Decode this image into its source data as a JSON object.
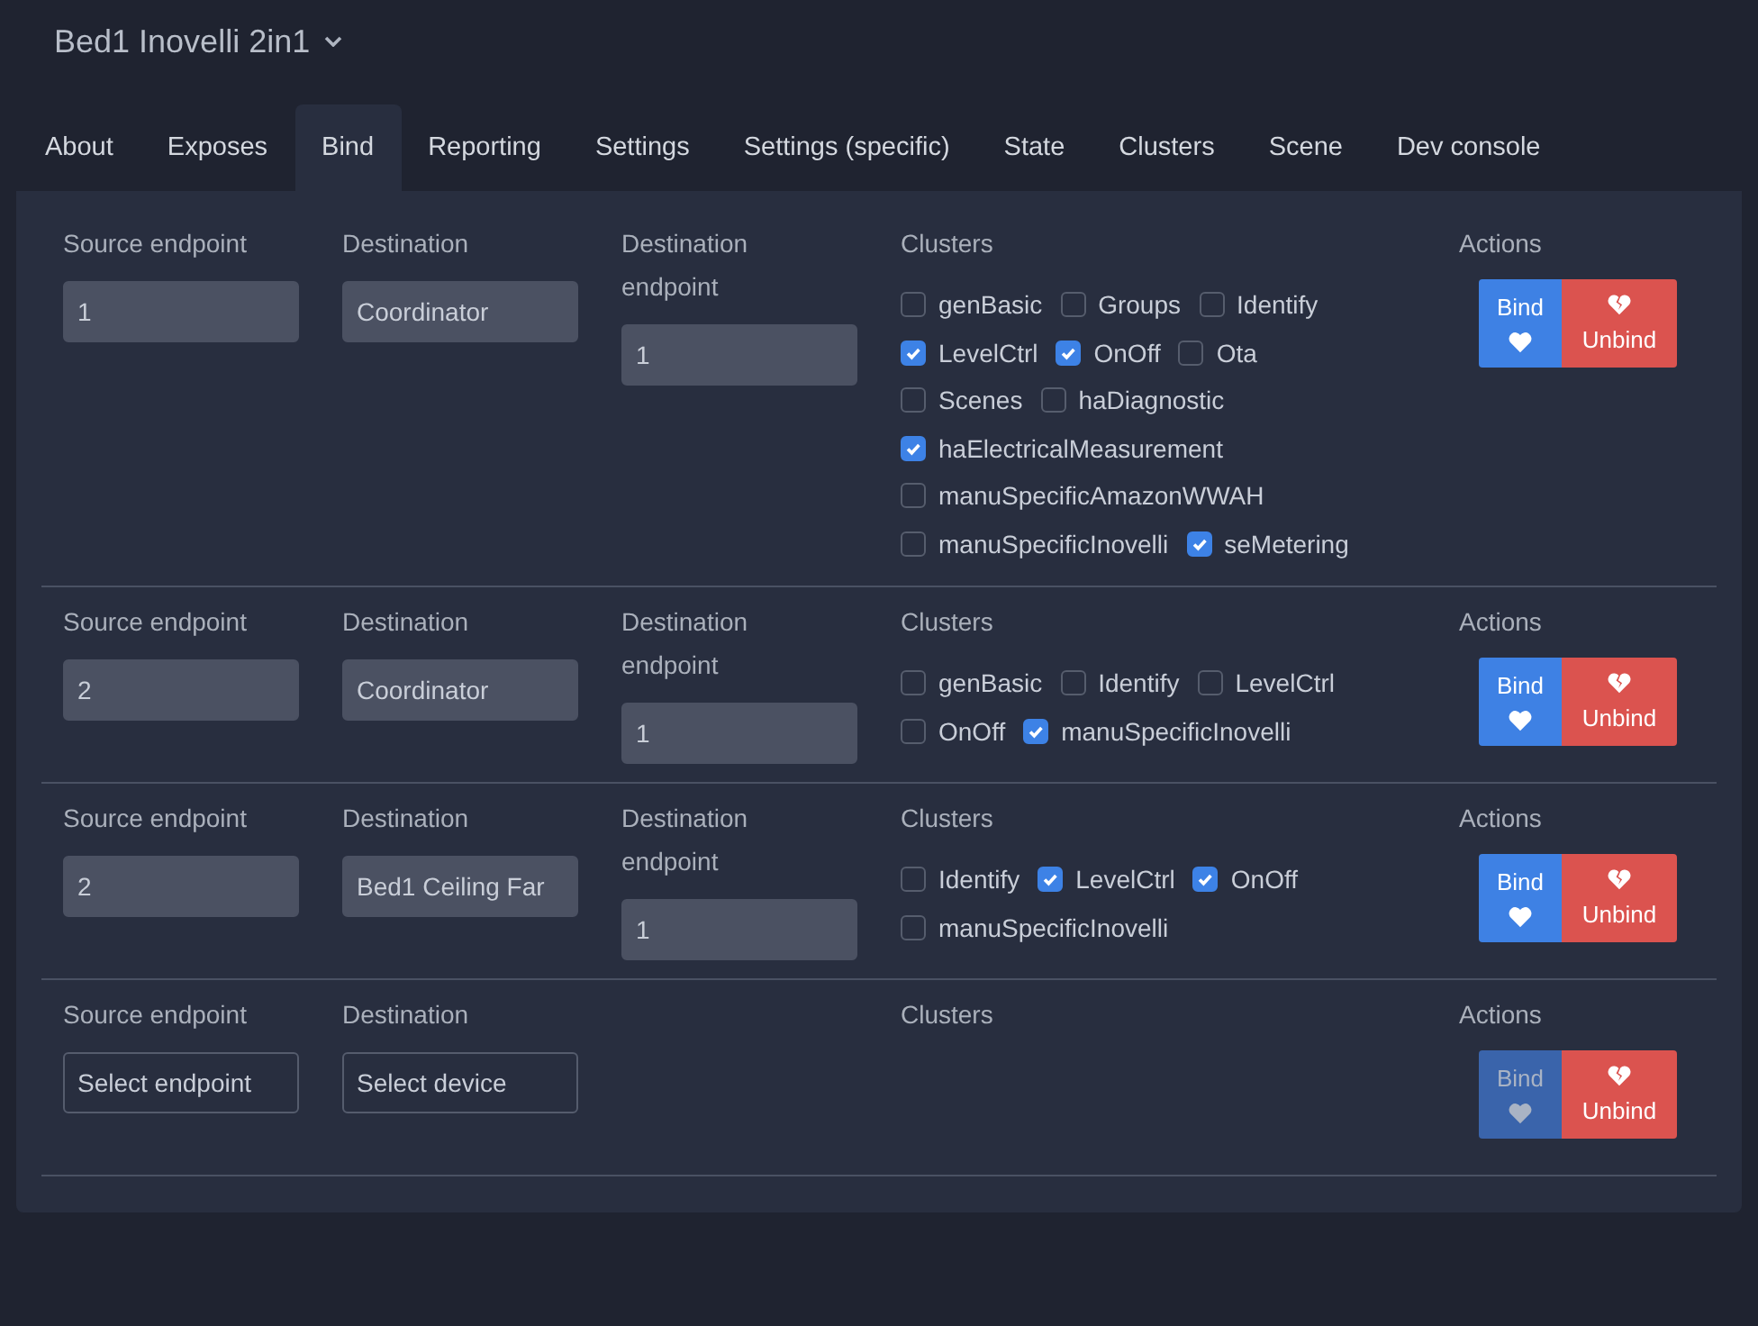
{
  "device": {
    "title": "Bed1 Inovelli 2in1"
  },
  "tabs": [
    {
      "label": "About",
      "selected": false
    },
    {
      "label": "Exposes",
      "selected": false
    },
    {
      "label": "Bind",
      "selected": true
    },
    {
      "label": "Reporting",
      "selected": false
    },
    {
      "label": "Settings",
      "selected": false
    },
    {
      "label": "Settings (specific)",
      "selected": false
    },
    {
      "label": "State",
      "selected": false
    },
    {
      "label": "Clusters",
      "selected": false
    },
    {
      "label": "Scene",
      "selected": false
    },
    {
      "label": "Dev console",
      "selected": false
    }
  ],
  "bindings": [
    {
      "source_endpoint": {
        "label": "Source endpoint",
        "value": "1"
      },
      "destination": {
        "label": "Destination",
        "value": "Coordinator"
      },
      "destination_endpoint": {
        "label": "Destination endpoint",
        "value": "1"
      },
      "clusters_label": "Clusters",
      "clusters": [
        {
          "name": "genBasic",
          "checked": false
        },
        {
          "name": "Groups",
          "checked": false
        },
        {
          "name": "Identify",
          "checked": false
        },
        {
          "name": "LevelCtrl",
          "checked": true
        },
        {
          "name": "OnOff",
          "checked": true
        },
        {
          "name": "Ota",
          "checked": false
        },
        {
          "name": "Scenes",
          "checked": false
        },
        {
          "name": "haDiagnostic",
          "checked": false
        },
        {
          "name": "haElectricalMeasurement",
          "checked": true
        },
        {
          "name": "manuSpecificAmazonWWAH",
          "checked": false
        },
        {
          "name": "manuSpecificInovelli",
          "checked": false
        },
        {
          "name": "seMetering",
          "checked": true
        }
      ],
      "actions_label": "Actions",
      "bind": {
        "label": "Bind",
        "disabled": false
      },
      "unbind": {
        "label": "Unbind"
      }
    },
    {
      "source_endpoint": {
        "label": "Source endpoint",
        "value": "2"
      },
      "destination": {
        "label": "Destination",
        "value": "Coordinator"
      },
      "destination_endpoint": {
        "label": "Destination endpoint",
        "value": "1"
      },
      "clusters_label": "Clusters",
      "clusters": [
        {
          "name": "genBasic",
          "checked": false
        },
        {
          "name": "Identify",
          "checked": false
        },
        {
          "name": "LevelCtrl",
          "checked": false
        },
        {
          "name": "OnOff",
          "checked": false
        },
        {
          "name": "manuSpecificInovelli",
          "checked": true
        }
      ],
      "actions_label": "Actions",
      "bind": {
        "label": "Bind",
        "disabled": false
      },
      "unbind": {
        "label": "Unbind"
      }
    },
    {
      "source_endpoint": {
        "label": "Source endpoint",
        "value": "2"
      },
      "destination": {
        "label": "Destination",
        "value": "Bed1 Ceiling Far"
      },
      "destination_endpoint": {
        "label": "Destination endpoint",
        "value": "1"
      },
      "clusters_label": "Clusters",
      "clusters": [
        {
          "name": "Identify",
          "checked": false
        },
        {
          "name": "LevelCtrl",
          "checked": true
        },
        {
          "name": "OnOff",
          "checked": true
        },
        {
          "name": "manuSpecificInovelli",
          "checked": false
        }
      ],
      "actions_label": "Actions",
      "bind": {
        "label": "Bind",
        "disabled": false
      },
      "unbind": {
        "label": "Unbind"
      }
    },
    {
      "source_endpoint": {
        "label": "Source endpoint",
        "placeholder": "Select endpoint"
      },
      "destination": {
        "label": "Destination",
        "placeholder": "Select device"
      },
      "clusters_label": "Clusters",
      "actions_label": "Actions",
      "bind": {
        "label": "Bind",
        "disabled": true
      },
      "unbind": {
        "label": "Unbind"
      }
    }
  ]
}
